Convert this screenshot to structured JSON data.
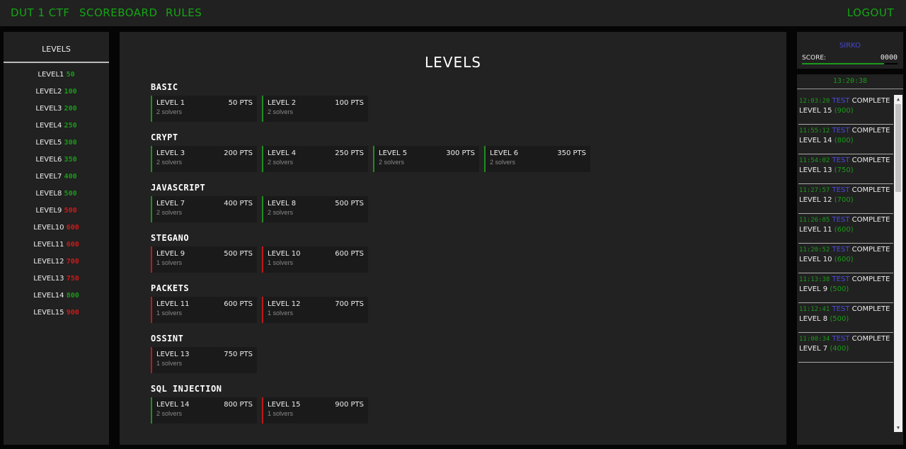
{
  "nav": {
    "brand": "DUT 1 CTF",
    "scoreboard": "SCOREBOARD",
    "rules": "RULES",
    "logout": "LOGOUT"
  },
  "sidebar": {
    "title": "LEVELS",
    "items": [
      {
        "label": "LEVEL1",
        "pts": "50",
        "color": "green"
      },
      {
        "label": "LEVEL2",
        "pts": "100",
        "color": "green"
      },
      {
        "label": "LEVEL3",
        "pts": "200",
        "color": "green"
      },
      {
        "label": "LEVEL4",
        "pts": "250",
        "color": "green"
      },
      {
        "label": "LEVEL5",
        "pts": "300",
        "color": "green"
      },
      {
        "label": "LEVEL6",
        "pts": "350",
        "color": "green"
      },
      {
        "label": "LEVEL7",
        "pts": "400",
        "color": "green"
      },
      {
        "label": "LEVEL8",
        "pts": "500",
        "color": "green"
      },
      {
        "label": "LEVEL9",
        "pts": "500",
        "color": "red"
      },
      {
        "label": "LEVEL10",
        "pts": "600",
        "color": "red"
      },
      {
        "label": "LEVEL11",
        "pts": "600",
        "color": "red"
      },
      {
        "label": "LEVEL12",
        "pts": "700",
        "color": "red"
      },
      {
        "label": "LEVEL13",
        "pts": "750",
        "color": "red"
      },
      {
        "label": "LEVEL14",
        "pts": "800",
        "color": "green"
      },
      {
        "label": "LEVEL15",
        "pts": "900",
        "color": "red"
      }
    ]
  },
  "main": {
    "title": "LEVELS",
    "categories": [
      {
        "name": "BASIC",
        "levels": [
          {
            "name": "LEVEL 1",
            "pts": "50 PTS",
            "solvers": "2 solvers",
            "status": "green"
          },
          {
            "name": "LEVEL 2",
            "pts": "100 PTS",
            "solvers": "2 solvers",
            "status": "green"
          }
        ]
      },
      {
        "name": "CRYPT",
        "levels": [
          {
            "name": "LEVEL 3",
            "pts": "200 PTS",
            "solvers": "2 solvers",
            "status": "green"
          },
          {
            "name": "LEVEL 4",
            "pts": "250 PTS",
            "solvers": "2 solvers",
            "status": "green"
          },
          {
            "name": "LEVEL 5",
            "pts": "300 PTS",
            "solvers": "2 solvers",
            "status": "green"
          },
          {
            "name": "LEVEL 6",
            "pts": "350 PTS",
            "solvers": "2 solvers",
            "status": "green"
          }
        ]
      },
      {
        "name": "JAVASCRIPT",
        "levels": [
          {
            "name": "LEVEL 7",
            "pts": "400 PTS",
            "solvers": "2 solvers",
            "status": "green"
          },
          {
            "name": "LEVEL 8",
            "pts": "500 PTS",
            "solvers": "2 solvers",
            "status": "green"
          }
        ]
      },
      {
        "name": "STEGANO",
        "levels": [
          {
            "name": "LEVEL 9",
            "pts": "500 PTS",
            "solvers": "1 solvers",
            "status": "red"
          },
          {
            "name": "LEVEL 10",
            "pts": "600 PTS",
            "solvers": "1 solvers",
            "status": "red"
          }
        ]
      },
      {
        "name": "PACKETS",
        "levels": [
          {
            "name": "LEVEL 11",
            "pts": "600 PTS",
            "solvers": "1 solvers",
            "status": "red"
          },
          {
            "name": "LEVEL 12",
            "pts": "700 PTS",
            "solvers": "1 solvers",
            "status": "red"
          }
        ]
      },
      {
        "name": "OSSINT",
        "levels": [
          {
            "name": "LEVEL 13",
            "pts": "750 PTS",
            "solvers": "1 solvers",
            "status": "red"
          }
        ]
      },
      {
        "name": "SQL INJECTION",
        "levels": [
          {
            "name": "LEVEL 14",
            "pts": "800 PTS",
            "solvers": "2 solvers",
            "status": "green"
          },
          {
            "name": "LEVEL 15",
            "pts": "900 PTS",
            "solvers": "1 solvers",
            "status": "red"
          }
        ]
      }
    ]
  },
  "user": {
    "name": "SIRKO",
    "score_label": "SCORE:",
    "score": "0000",
    "progress": 0.86
  },
  "feed": {
    "clock": "13:20:38",
    "items": [
      {
        "time": "12:03:20",
        "user": "TEST",
        "action": "COMPLETE",
        "level": "LEVEL 15",
        "pts": "(900)"
      },
      {
        "time": "11:55:12",
        "user": "TEST",
        "action": "COMPLETE",
        "level": "LEVEL 14",
        "pts": "(800)"
      },
      {
        "time": "11:54:02",
        "user": "TEST",
        "action": "COMPLETE",
        "level": "LEVEL 13",
        "pts": "(750)"
      },
      {
        "time": "11:27:57",
        "user": "TEST",
        "action": "COMPLETE",
        "level": "LEVEL 12",
        "pts": "(700)"
      },
      {
        "time": "11:26:05",
        "user": "TEST",
        "action": "COMPLETE",
        "level": "LEVEL 11",
        "pts": "(600)"
      },
      {
        "time": "11:20:52",
        "user": "TEST",
        "action": "COMPLETE",
        "level": "LEVEL 10",
        "pts": "(600)"
      },
      {
        "time": "11:13:38",
        "user": "TEST",
        "action": "COMPLETE",
        "level": "LEVEL 9",
        "pts": "(500)"
      },
      {
        "time": "11:12:41",
        "user": "TEST",
        "action": "COMPLETE",
        "level": "LEVEL 8",
        "pts": "(500)"
      },
      {
        "time": "11:00:34",
        "user": "TEST",
        "action": "COMPLETE",
        "level": "LEVEL 7",
        "pts": "(400)"
      }
    ]
  },
  "colors": {
    "green": "#1a9a1a",
    "red": "#d01818",
    "user": "#4a4ae0"
  }
}
